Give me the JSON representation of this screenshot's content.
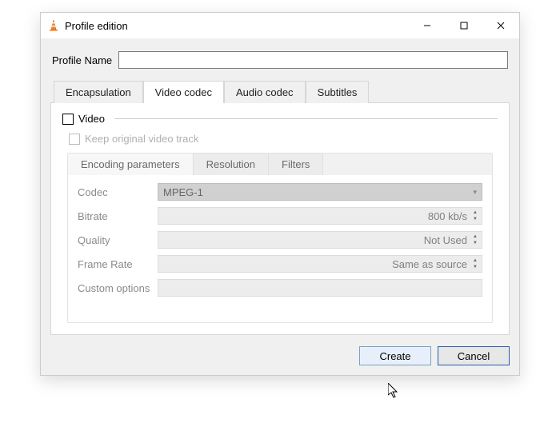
{
  "window": {
    "title": "Profile edition"
  },
  "profileName": {
    "label": "Profile Name",
    "value": ""
  },
  "tabs": {
    "encapsulation": "Encapsulation",
    "videoCodec": "Video codec",
    "audioCodec": "Audio codec",
    "subtitles": "Subtitles"
  },
  "videoGroup": {
    "legend": "Video",
    "keepOriginal": "Keep original video track"
  },
  "innerTabs": {
    "encodingParams": "Encoding parameters",
    "resolution": "Resolution",
    "filters": "Filters"
  },
  "params": {
    "codec": {
      "label": "Codec",
      "value": "MPEG-1"
    },
    "bitrate": {
      "label": "Bitrate",
      "value": "800 kb/s"
    },
    "quality": {
      "label": "Quality",
      "value": "Not Used"
    },
    "frameRate": {
      "label": "Frame Rate",
      "value": "Same as source"
    },
    "customOptions": {
      "label": "Custom options",
      "value": ""
    }
  },
  "buttons": {
    "create": "Create",
    "cancel": "Cancel"
  }
}
